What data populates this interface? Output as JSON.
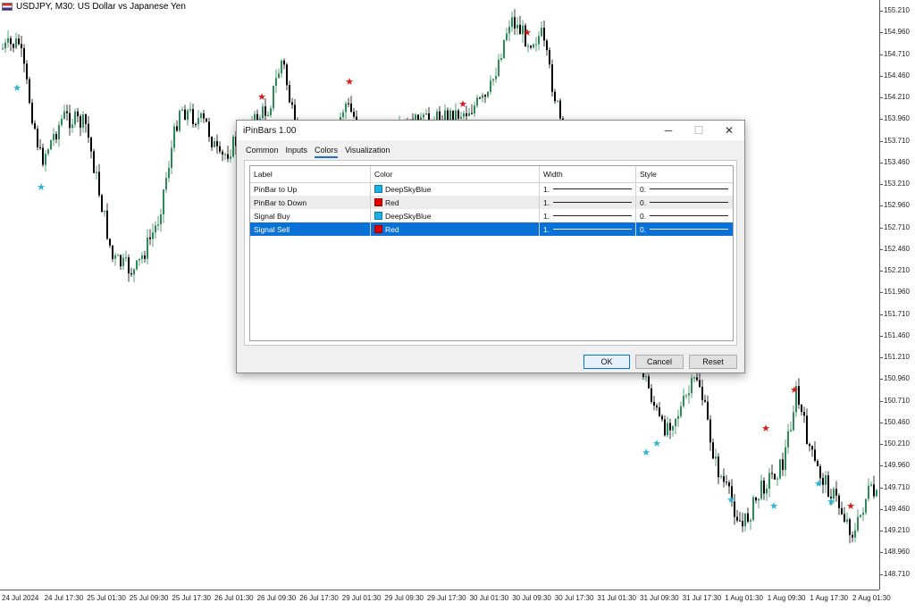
{
  "window": {
    "symbol_title": "USDJPY, M30:  US Dollar vs Japanese Yen"
  },
  "price_axis": {
    "labels": [
      "155.210",
      "154.960",
      "154.710",
      "154.460",
      "154.210",
      "153.960",
      "153.710",
      "153.460",
      "153.210",
      "152.960",
      "152.710",
      "152.460",
      "152.210",
      "151.960",
      "151.710",
      "151.460",
      "151.210",
      "150.960",
      "150.710",
      "150.460",
      "150.210",
      "149.960",
      "149.710",
      "149.460",
      "149.210",
      "148.960",
      "148.710"
    ]
  },
  "time_axis": {
    "labels": [
      "24 Jul 2024",
      "24 Jul 17:30",
      "25 Jul 01:30",
      "25 Jul 09:30",
      "25 Jul 17:30",
      "26 Jul 01:30",
      "26 Jul 09:30",
      "26 Jul 17:30",
      "29 Jul 01:30",
      "29 Jul 09:30",
      "29 Jul 17:30",
      "30 Jul 01:30",
      "30 Jul 09:30",
      "30 Jul 17:30",
      "31 Jul 01:30",
      "31 Jul 09:30",
      "31 Jul 17:30",
      "1 Aug 01:30",
      "1 Aug 09:30",
      "1 Aug 17:30",
      "2 Aug 01:30"
    ]
  },
  "colors": {
    "up_marker": "#29b6d6",
    "down_marker": "#d61a1a",
    "candle_bull": "#2e8b57",
    "candle_bear": "#000000",
    "selection": "#0a72d6"
  },
  "dialog": {
    "title": "iPinBars 1.00",
    "minimize_icon": "─",
    "maximize_icon": "☐",
    "close_icon": "✕",
    "tabs": [
      {
        "label": "Common"
      },
      {
        "label": "Inputs"
      },
      {
        "label": "Colors"
      },
      {
        "label": "Visualization"
      }
    ],
    "active_tab": "Colors",
    "columns": {
      "label": "Label",
      "color": "Color",
      "width": "Width",
      "style": "Style"
    },
    "rows": [
      {
        "label": "PinBar to Up",
        "color_name": "DeepSkyBlue",
        "swatch": "#1ab2e6",
        "width": "1.",
        "style": "0."
      },
      {
        "label": "PinBar to Down",
        "color_name": "Red",
        "swatch": "#e00000",
        "width": "1.",
        "style": "0."
      },
      {
        "label": "Signal Buy",
        "color_name": "DeepSkyBlue",
        "swatch": "#1ab2e6",
        "width": "1.",
        "style": "0."
      },
      {
        "label": "Signal Sell",
        "color_name": "Red",
        "swatch": "#e00000",
        "width": "1.",
        "style": "0."
      }
    ],
    "selected_row": "Signal Sell",
    "buttons": {
      "ok": "OK",
      "cancel": "Cancel",
      "reset": "Reset"
    }
  }
}
